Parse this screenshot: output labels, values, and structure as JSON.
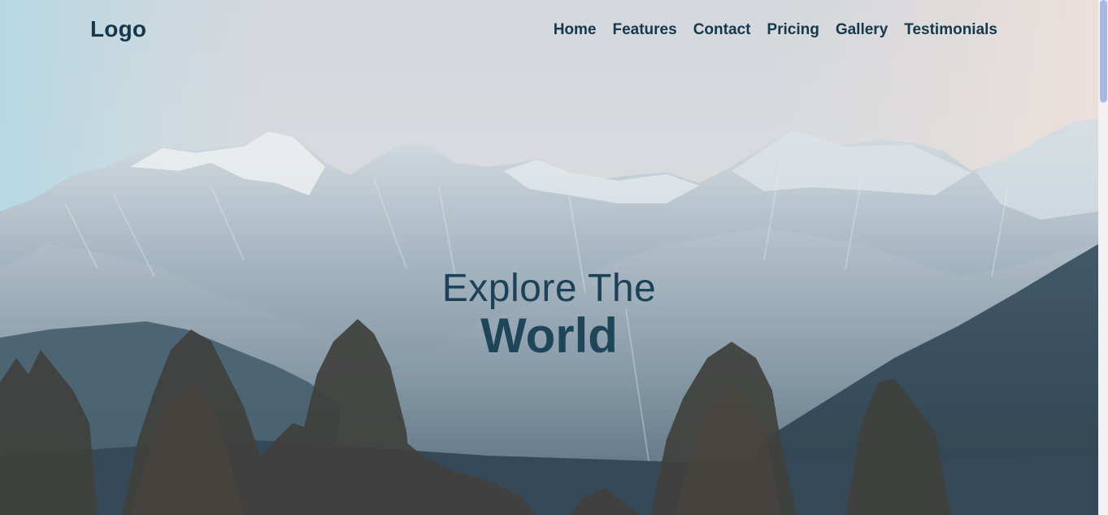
{
  "header": {
    "logo": "Logo",
    "nav": [
      "Home",
      "Features",
      "Contact",
      "Pricing",
      "Gallery",
      "Testimonials"
    ]
  },
  "hero": {
    "title_line1": "Explore The",
    "title_line2": "World",
    "background": "snowy mountain range with pine trees"
  },
  "colors": {
    "text": "#15384d",
    "sky": "#d6d9de",
    "mountain": "#6f8799",
    "forest": "#1b3346"
  }
}
